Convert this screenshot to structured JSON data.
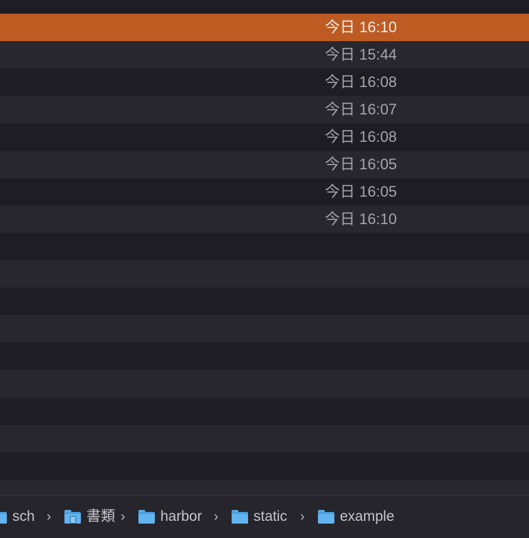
{
  "files": {
    "rows": [
      {
        "modified": "今日 16:10",
        "selected": true
      },
      {
        "modified": "今日 15:44",
        "selected": false
      },
      {
        "modified": "今日 16:08",
        "selected": false
      },
      {
        "modified": "今日 16:07",
        "selected": false
      },
      {
        "modified": "今日 16:08",
        "selected": false
      },
      {
        "modified": "今日 16:05",
        "selected": false
      },
      {
        "modified": "今日 16:05",
        "selected": false
      },
      {
        "modified": "今日 16:10",
        "selected": false
      }
    ],
    "selection_color": "#bd5b22"
  },
  "pathbar": {
    "items": [
      {
        "label": "sch",
        "icon": "home-folder-icon"
      },
      {
        "label": "書類",
        "icon": "documents-folder-icon"
      },
      {
        "label": "harbor",
        "icon": "folder-icon"
      },
      {
        "label": "static",
        "icon": "folder-icon"
      },
      {
        "label": "example",
        "icon": "folder-icon"
      }
    ],
    "separator": "›"
  }
}
